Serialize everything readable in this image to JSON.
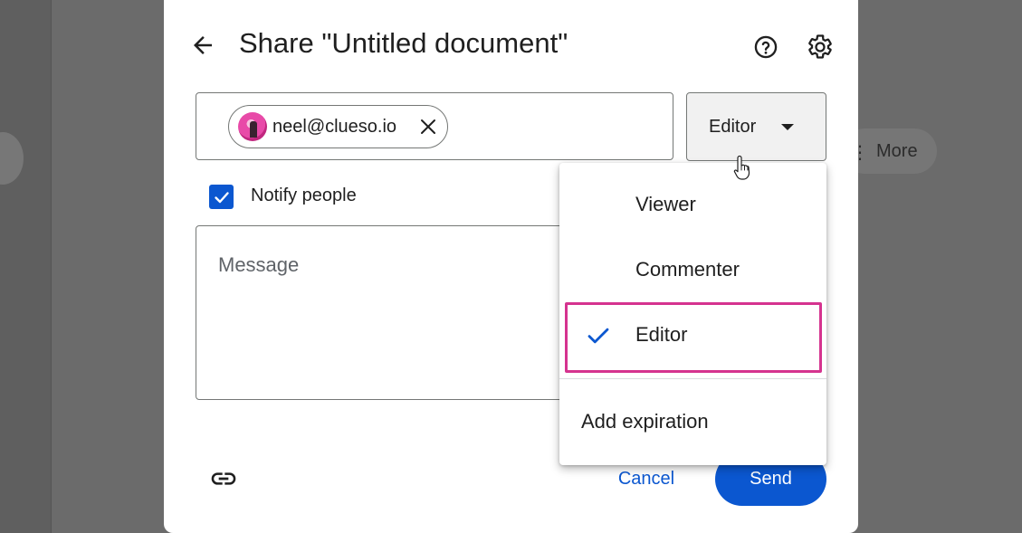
{
  "background": {
    "more_label": "More"
  },
  "dialog": {
    "title": "Share \"Untitled document\"",
    "recipient_chip": {
      "email": "neel@clueso.io"
    },
    "role_select": {
      "selected": "Editor"
    },
    "notify": {
      "label": "Notify people",
      "checked": true
    },
    "message": {
      "placeholder": "Message"
    },
    "cancel_label": "Cancel",
    "send_label": "Send"
  },
  "role_menu": {
    "items": [
      {
        "label": "Viewer",
        "selected": false
      },
      {
        "label": "Commenter",
        "selected": false
      },
      {
        "label": "Editor",
        "selected": true
      }
    ],
    "extra_item": "Add expiration"
  },
  "colors": {
    "accent": "#0b57d0",
    "highlight": "#d5338f",
    "text": "#1f1f1f"
  }
}
